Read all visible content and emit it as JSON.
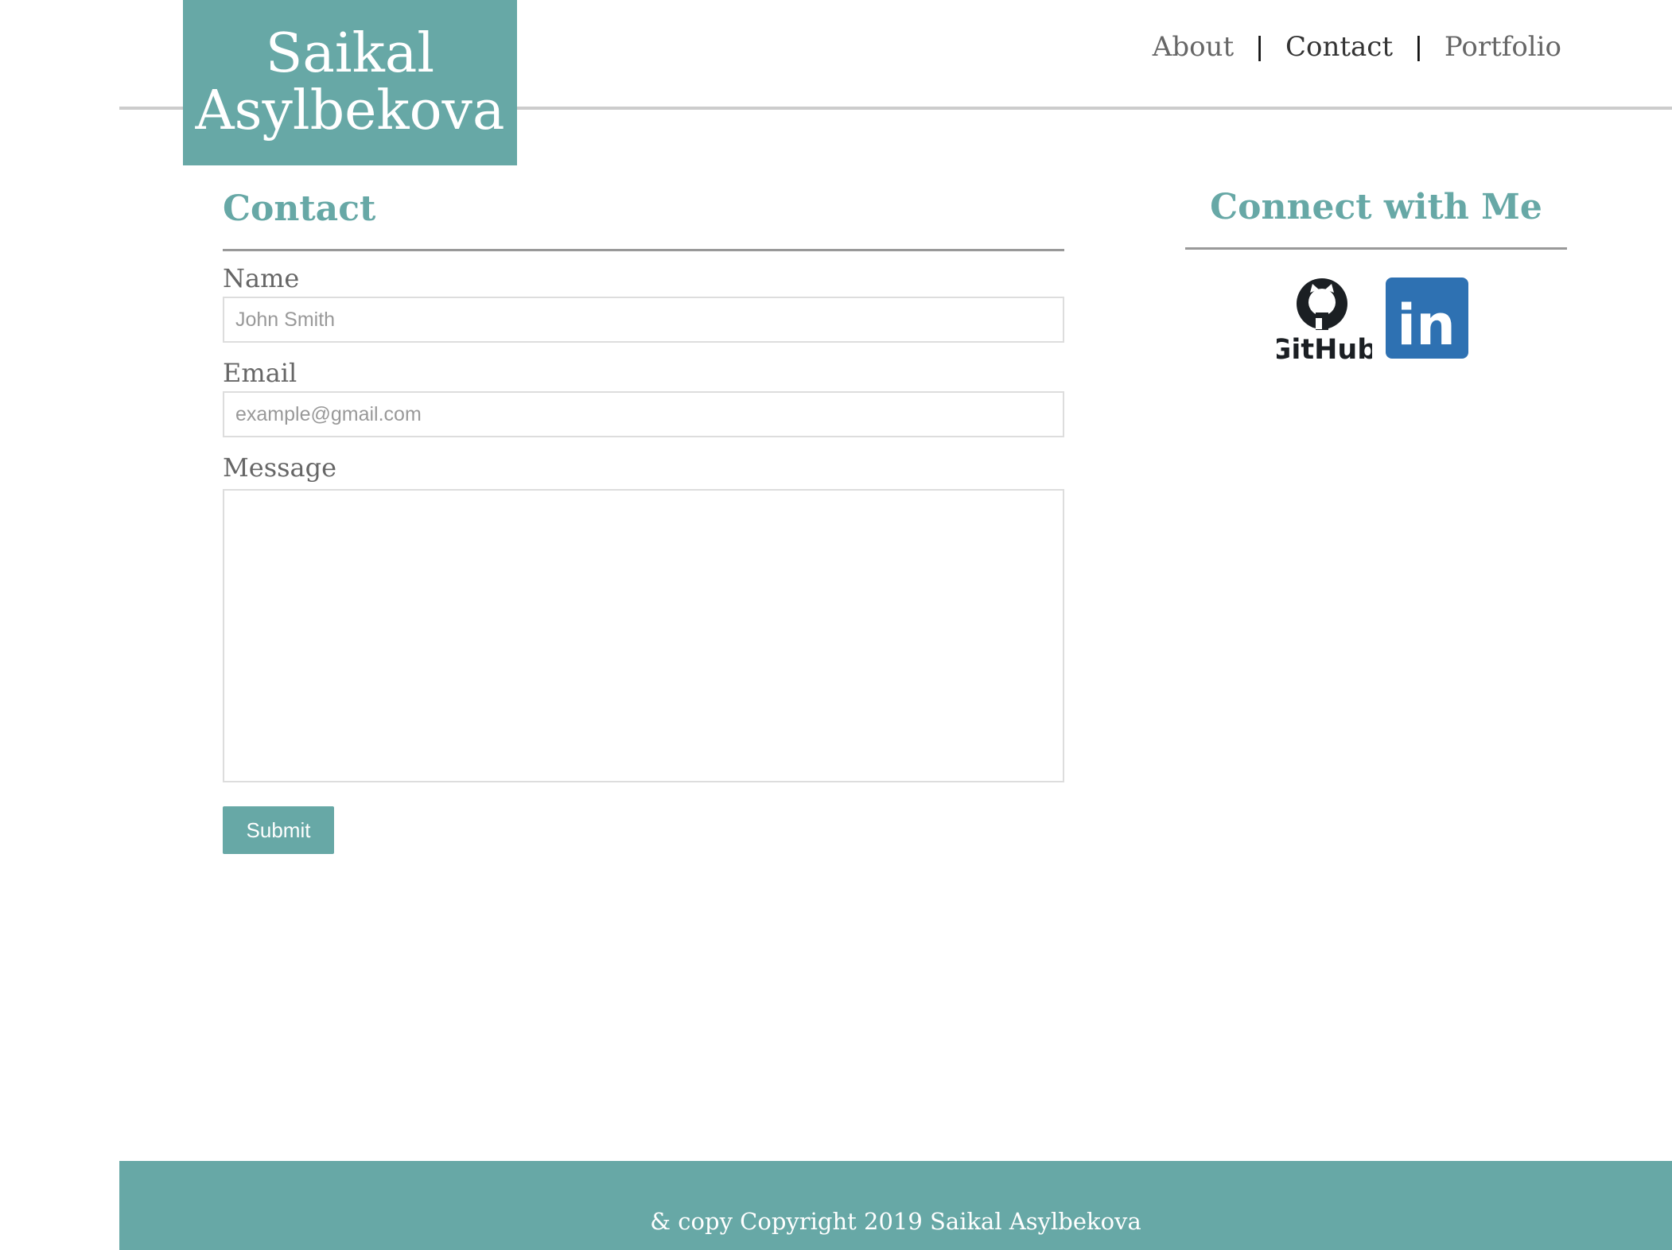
{
  "brand": {
    "name": "Saikal\nAsylbekova"
  },
  "nav": {
    "items": [
      {
        "label": "About"
      },
      {
        "label": "Contact"
      },
      {
        "label": "Portfolio"
      }
    ],
    "separator": "|"
  },
  "contact": {
    "title": "Contact",
    "fields": {
      "name": {
        "label": "Name",
        "placeholder": "John Smith",
        "value": ""
      },
      "email": {
        "label": "Email",
        "placeholder": "example@gmail.com",
        "value": ""
      },
      "message": {
        "label": "Message",
        "value": ""
      }
    },
    "submit_label": "Submit"
  },
  "connect": {
    "title": "Connect with Me",
    "links": [
      {
        "label": "GitHub",
        "icon": "github-icon"
      },
      {
        "label": "in",
        "icon": "linkedin-icon",
        "color": "#2e71b2"
      }
    ]
  },
  "footer": {
    "copyright": "& copy Copyright 2019 Saikal Asylbekova"
  },
  "colors": {
    "accent": "#67a8a6",
    "nav_active": "#333333",
    "nav_inactive": "#666666"
  }
}
